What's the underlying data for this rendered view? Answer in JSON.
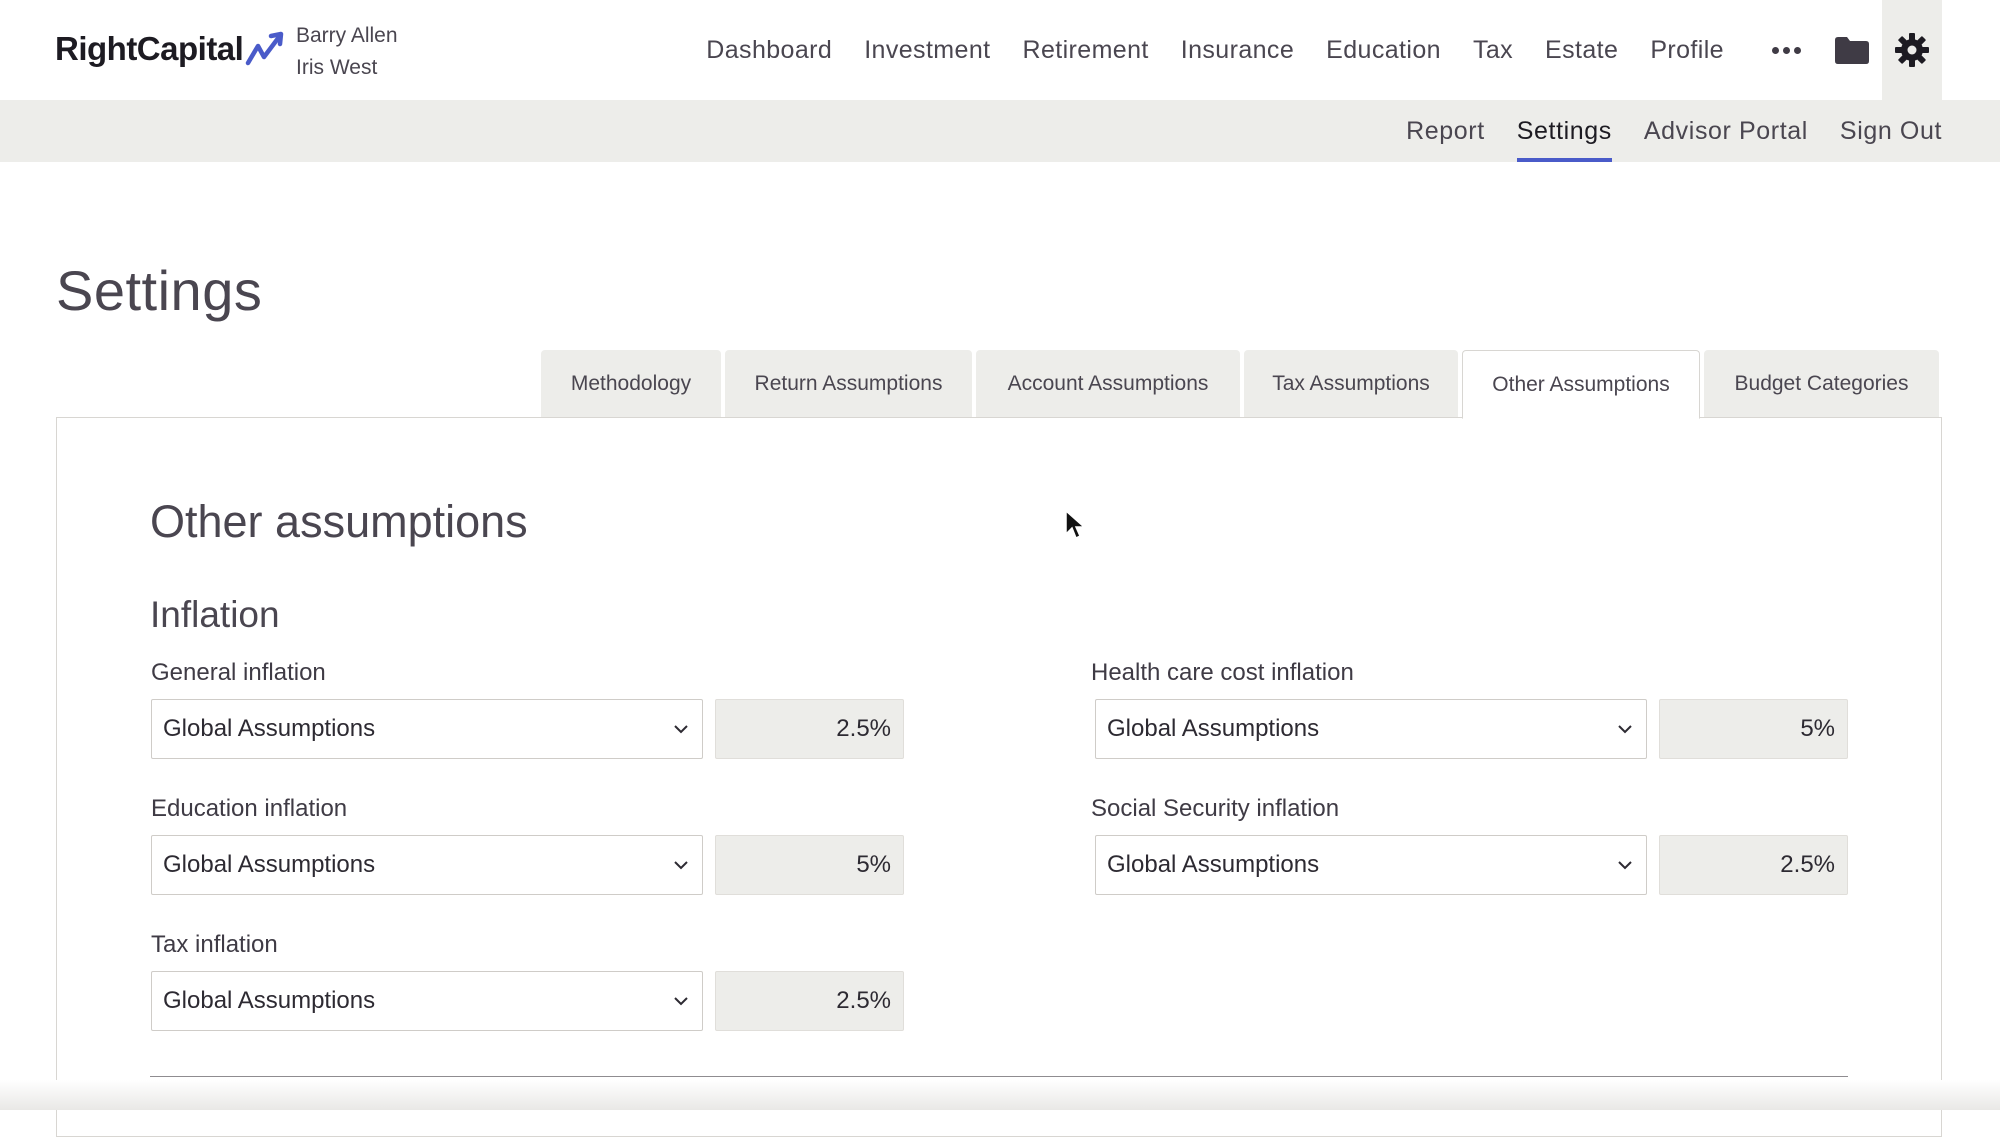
{
  "brand": {
    "logo_text": "RightCapital"
  },
  "clients": [
    "Barry Allen",
    "Iris West"
  ],
  "main_nav": [
    "Dashboard",
    "Investment",
    "Retirement",
    "Insurance",
    "Education",
    "Tax",
    "Estate",
    "Profile"
  ],
  "icons": {
    "more": "more-dots-icon",
    "files": "folder-icon",
    "settings": "gear-icon",
    "dropdown": "chevron-down-icon"
  },
  "sub_nav": {
    "items": [
      "Report",
      "Settings",
      "Advisor Portal",
      "Sign Out"
    ],
    "active": "Settings",
    "accent": "#4a5bc9"
  },
  "page": {
    "title": "Settings"
  },
  "tabs": {
    "items": [
      "Methodology",
      "Return Assumptions",
      "Account Assumptions",
      "Tax Assumptions",
      "Other Assumptions",
      "Budget Categories"
    ],
    "active": "Other Assumptions"
  },
  "panel": {
    "title": "Other assumptions",
    "section": "Inflation",
    "fields": {
      "general": {
        "label": "General inflation",
        "select": "Global Assumptions",
        "value": "2.5%"
      },
      "health": {
        "label": "Health care cost inflation",
        "select": "Global Assumptions",
        "value": "5%"
      },
      "education": {
        "label": "Education inflation",
        "select": "Global Assumptions",
        "value": "5%"
      },
      "social_security": {
        "label": "Social Security inflation",
        "select": "Global Assumptions",
        "value": "2.5%"
      },
      "tax": {
        "label": "Tax inflation",
        "select": "Global Assumptions",
        "value": "2.5%"
      }
    }
  }
}
